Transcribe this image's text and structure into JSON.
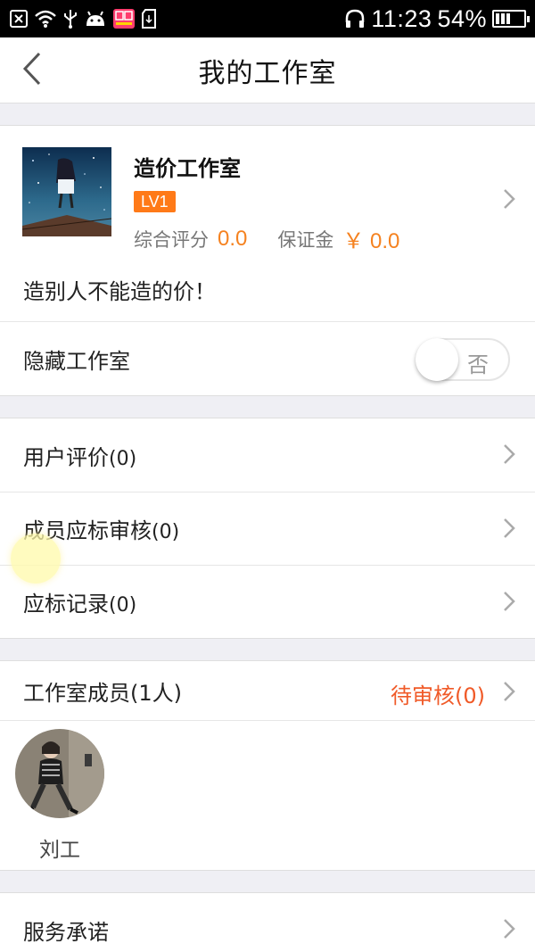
{
  "status_bar": {
    "time": "11:23",
    "battery_percent": "54%",
    "icons": [
      "close-box-icon",
      "wifi-icon",
      "usb-icon",
      "android-icon",
      "app-badge-icon",
      "sd-card-icon",
      "headphones-icon",
      "battery-icon"
    ],
    "battery_level": 0.54
  },
  "header": {
    "title": "我的工作室",
    "back_icon": "chevron-left-icon"
  },
  "studio": {
    "name": "造价工作室",
    "level": "LV1",
    "rating_label": "综合评分",
    "rating_value": "0.0",
    "deposit_label": "保证金",
    "deposit_value": "￥ 0.0",
    "slogan": "造别人不能造的价！"
  },
  "hide_setting": {
    "label": "隐藏工作室",
    "toggle_text": "否",
    "enabled": false
  },
  "menu": [
    {
      "label": "用户评价",
      "count": "(0)"
    },
    {
      "label": "成员应标审核",
      "count": "(0)"
    },
    {
      "label": "应标记录",
      "count": "(0)"
    }
  ],
  "members_section": {
    "label": "工作室成员",
    "count": "(1人)",
    "pending_label": "待审核",
    "pending_count": "(0)",
    "members": [
      {
        "name": "刘工"
      }
    ]
  },
  "service": {
    "label": "服务承诺"
  },
  "colors": {
    "accent_orange": "#f58220",
    "badge_orange": "#ff7a18",
    "pending_red": "#f05a28",
    "background": "#efeff4"
  }
}
